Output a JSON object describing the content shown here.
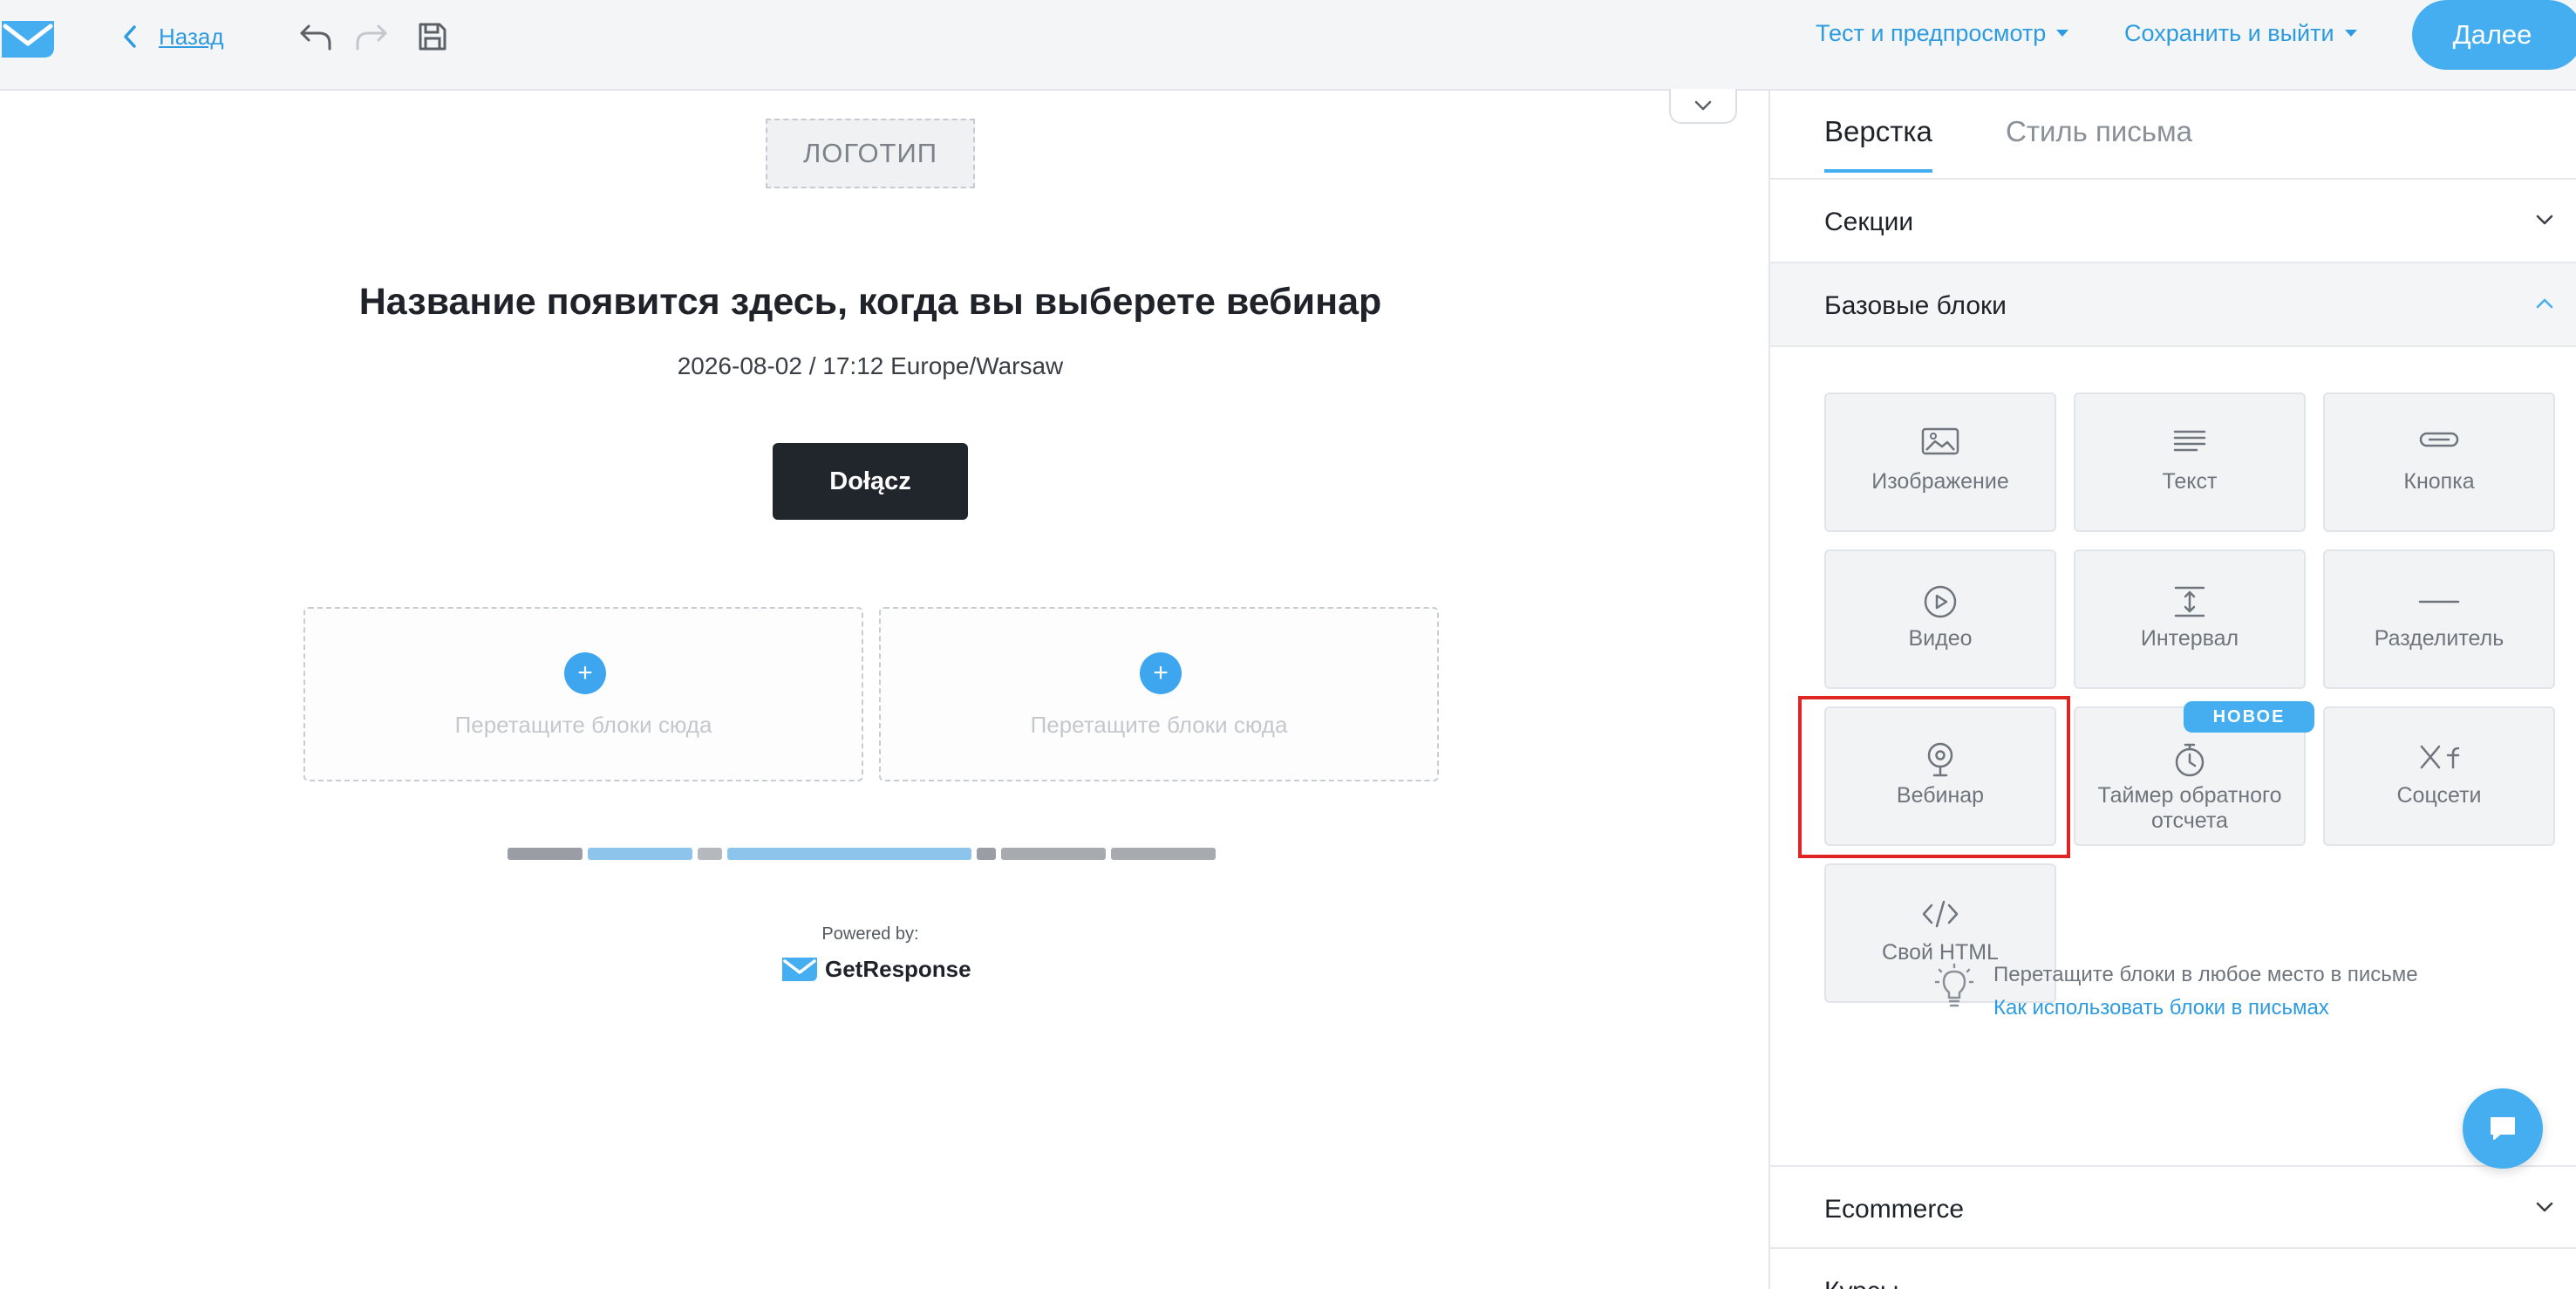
{
  "header": {
    "back_label": "Назад",
    "test_menu": "Тест и предпросмотр",
    "save_menu": "Сохранить и выйти",
    "next_button": "Далее"
  },
  "canvas": {
    "logo_placeholder": "ЛОГОТИП",
    "webinar_title": "Название появится здесь, когда вы выберете вебинар",
    "datetime": "2026-08-02 / 17:12 Europe/Warsaw",
    "join_button": "Dołącz",
    "drop_hint_left": "Перетащите блоки сюда",
    "drop_hint_right": "Перетащите блоки сюда",
    "powered_by": "Powered by:",
    "brand_name": "GetResponse"
  },
  "panel": {
    "tabs": [
      {
        "label": "Верстка",
        "active": true
      },
      {
        "label": "Стиль письма",
        "active": false
      }
    ],
    "sections": [
      "Секции",
      "Базовые блоки",
      "Ecommerce",
      "Курсы"
    ],
    "blocks": [
      {
        "label": "Изображение",
        "icon": "image-icon"
      },
      {
        "label": "Текст",
        "icon": "text-icon"
      },
      {
        "label": "Кнопка",
        "icon": "button-icon"
      },
      {
        "label": "Видео",
        "icon": "video-icon"
      },
      {
        "label": "Интервал",
        "icon": "spacer-icon"
      },
      {
        "label": "Разделитель",
        "icon": "divider-icon"
      },
      {
        "label": "Вебинар",
        "icon": "webcam-icon"
      },
      {
        "label": "Таймер обратного отсчета",
        "icon": "timer-icon"
      },
      {
        "label": "Соцсети",
        "icon": "social-icon"
      },
      {
        "label": "Свой HTML",
        "icon": "code-icon"
      }
    ],
    "new_badge": "НОВОЕ",
    "tip_text": "Перетащите блоки в любое место в письме",
    "tip_link": "Как использовать блоки в письмах"
  },
  "colors": {
    "accent": "#45aef0",
    "link": "#2d9bdf",
    "highlight": "#e02424",
    "dark_button": "#21262d"
  }
}
